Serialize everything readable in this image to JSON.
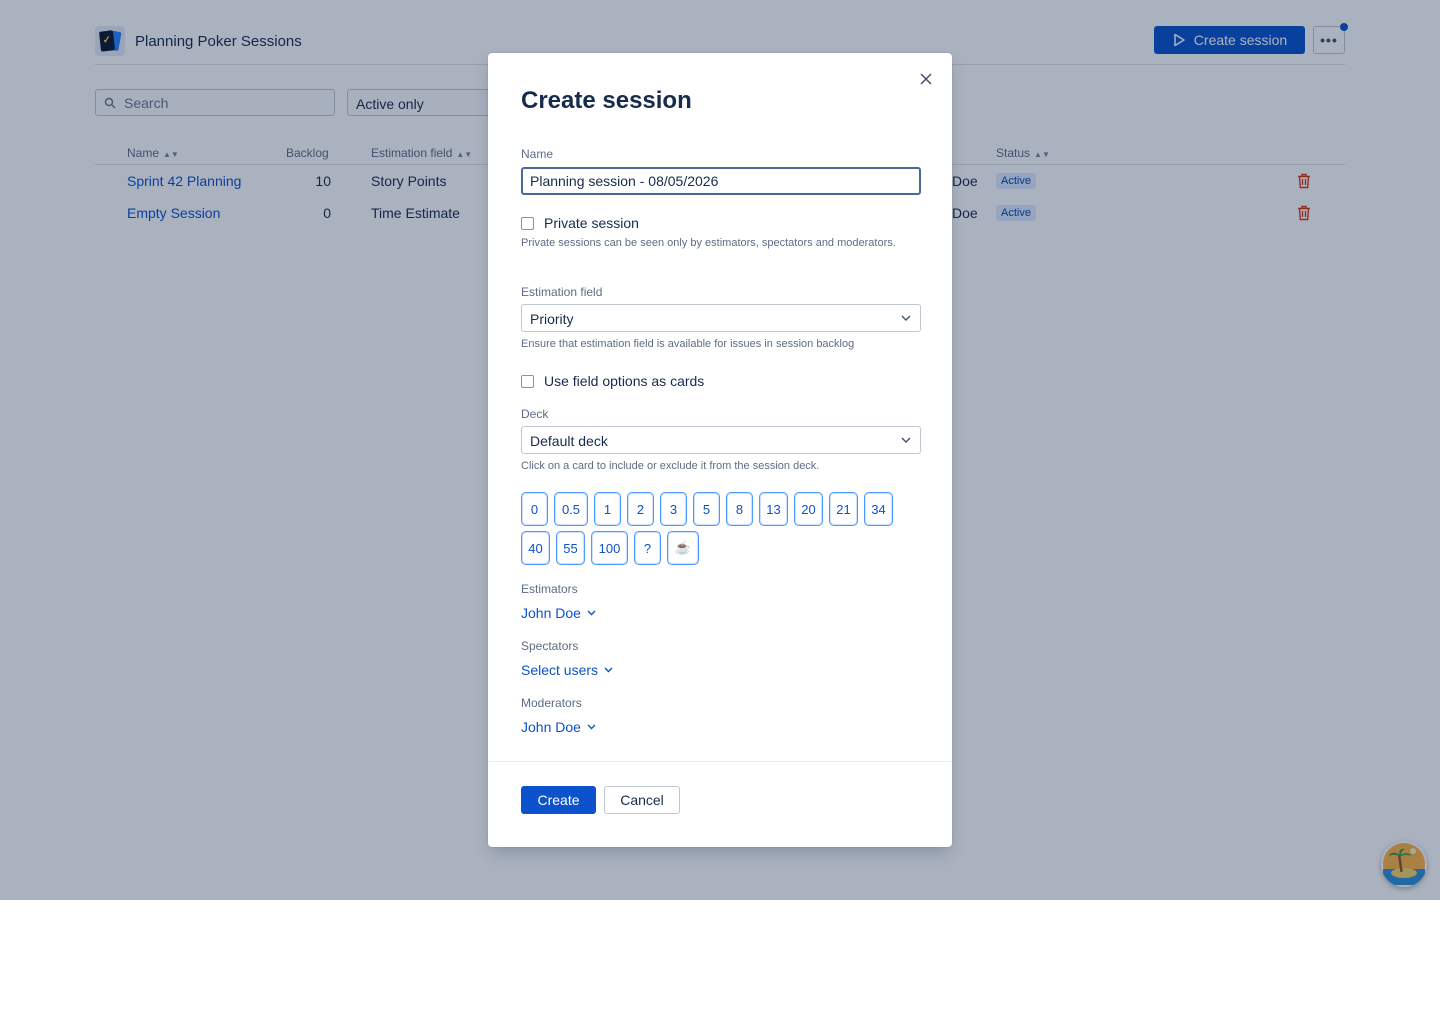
{
  "app": {
    "title": "Planning Poker Sessions",
    "create_session_label": "Create session",
    "more_label": "•••"
  },
  "filters": {
    "search_placeholder": "Search",
    "status_filter": "Active only"
  },
  "table": {
    "headers": {
      "name": "Name",
      "backlog": "Backlog",
      "estimation_field": "Estimation field",
      "status": "Status"
    },
    "rows": [
      {
        "name": "Sprint 42 Planning",
        "backlog": "10",
        "estimation_field": "Story Points",
        "owner_partial": "Doe",
        "status": "Active"
      },
      {
        "name": "Empty Session",
        "backlog": "0",
        "estimation_field": "Time Estimate",
        "owner_partial": "Doe",
        "status": "Active"
      }
    ]
  },
  "modal": {
    "title": "Create session",
    "name_label": "Name",
    "name_value": "Planning session - 08/05/2026",
    "private_label": "Private session",
    "private_help": "Private sessions can be seen only by estimators, spectators and moderators.",
    "estimation_label": "Estimation field",
    "estimation_value": "Priority",
    "estimation_help": "Ensure that estimation field is available for issues in session backlog",
    "field_options_label": "Use field options as cards",
    "deck_label": "Deck",
    "deck_value": "Default deck",
    "deck_help": "Click on a card to include or exclude it from the session deck.",
    "cards": [
      "0",
      "0.5",
      "1",
      "2",
      "3",
      "5",
      "8",
      "13",
      "20",
      "21",
      "34",
      "40",
      "55",
      "100",
      "?",
      "☕"
    ],
    "estimators_label": "Estimators",
    "estimators_value": "John Doe",
    "spectators_label": "Spectators",
    "spectators_value": "Select users",
    "moderators_label": "Moderators",
    "moderators_value": "John Doe",
    "create_label": "Create",
    "cancel_label": "Cancel"
  },
  "colors": {
    "primary": "#0c52cc",
    "danger": "#de350b",
    "lozenge_bg": "#deebff"
  }
}
